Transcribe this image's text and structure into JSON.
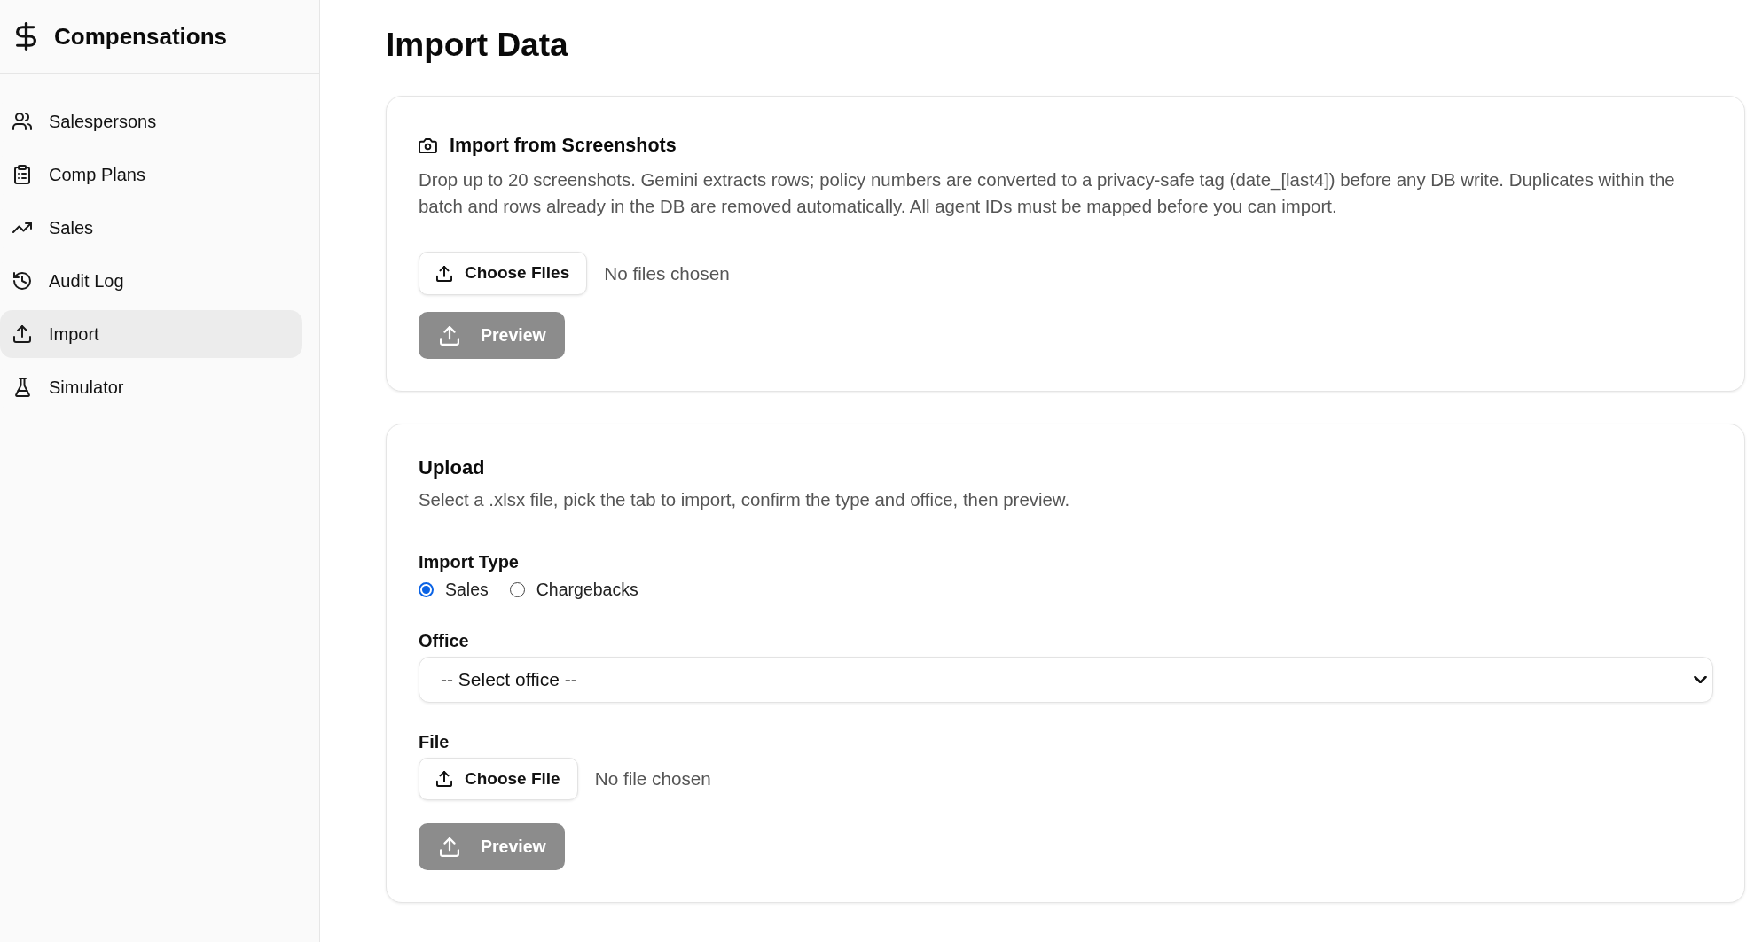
{
  "sidebar": {
    "brand": "Compensations",
    "items": [
      {
        "label": "Salespersons",
        "selected": false
      },
      {
        "label": "Comp Plans",
        "selected": false
      },
      {
        "label": "Sales",
        "selected": false
      },
      {
        "label": "Audit Log",
        "selected": false
      },
      {
        "label": "Import",
        "selected": true
      },
      {
        "label": "Simulator",
        "selected": false
      }
    ]
  },
  "page_title": "Import Data",
  "screenshot_import": {
    "title": "Import from Screenshots",
    "description": "Drop up to 20 screenshots. Gemini extracts rows; policy numbers are converted to a privacy-safe tag (date_[last4]) before any DB write. Duplicates within the batch and rows already in the DB are removed automatically. All agent IDs must be mapped before you can import.",
    "file_picker": {
      "button": "Choose Files",
      "status": "No files chosen"
    },
    "preview_button": {
      "label": "Preview",
      "disabled": true
    }
  },
  "upload": {
    "title": "Upload",
    "description": "Select a .xlsx file, pick the tab to import, confirm the type and office, then preview.",
    "import_type": {
      "label": "Import Type",
      "options": [
        {
          "label": "Sales",
          "selected": true
        },
        {
          "label": "Chargebacks",
          "selected": false
        }
      ]
    },
    "office": {
      "label": "Office",
      "value": "-- Select office --"
    },
    "file": {
      "label": "File",
      "button": "Choose File",
      "status": "No file chosen"
    },
    "preview_button": {
      "label": "Preview",
      "disabled": true
    }
  }
}
